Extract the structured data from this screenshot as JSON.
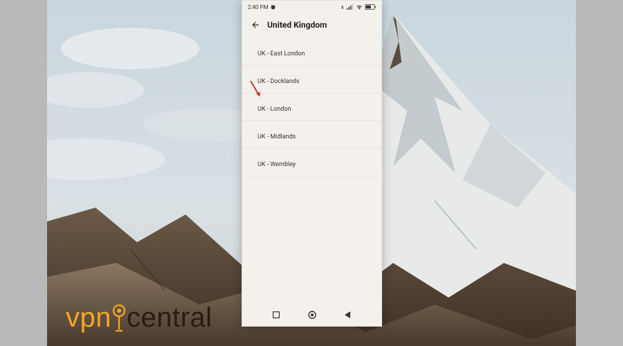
{
  "statusbar": {
    "time": "2:40 PM",
    "icons": {
      "alarm": "alarm-icon",
      "bluetooth": "bluetooth-icon",
      "signal": "signal-icon",
      "wifi": "wifi-icon",
      "battery": "battery-icon"
    }
  },
  "appbar": {
    "title": "United Kingdom",
    "back_icon": "back-arrow-icon"
  },
  "servers": [
    {
      "label": "UK - East London"
    },
    {
      "label": "UK - Docklands"
    },
    {
      "label": "UK - London"
    },
    {
      "label": "UK - Midlands"
    },
    {
      "label": "UK - Wembley"
    }
  ],
  "nav": {
    "recents": "recents-icon",
    "home": "home-icon",
    "back": "back-icon"
  },
  "watermark": {
    "part1": "vpn",
    "part2": "central",
    "pin_icon": "map-pin-icon"
  },
  "colors": {
    "phone_bg": "#f4f1ec",
    "divider": "#e6e2da",
    "accent_orange": "#f5a623",
    "annotation_red": "#c62828"
  }
}
